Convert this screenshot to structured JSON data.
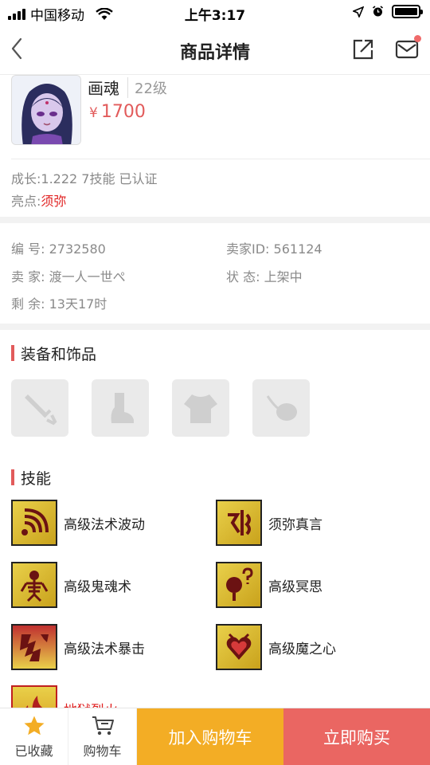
{
  "status_bar": {
    "carrier": "中国移动",
    "time": "上午3:17"
  },
  "nav": {
    "title": "商品详情"
  },
  "pet": {
    "name": "画魂",
    "level": "22级",
    "currency": "¥",
    "price": "1700"
  },
  "summary": {
    "growth_line": "成长:1.222 7技能 已认证",
    "highlight_label": "亮点:",
    "highlight_value": "须弥"
  },
  "info": {
    "id_label": "编 号:",
    "id_value": "2732580",
    "seller_id_label": "卖家ID:",
    "seller_id_value": "561124",
    "seller_label": "卖 家:",
    "seller_value": "渡一人一世ぺ",
    "status_label": "状 态:",
    "status_value": "上架中",
    "remain_label": "剩 余:",
    "remain_value": "13天17时"
  },
  "sections": {
    "equipment_title": "装备和饰品",
    "skills_title": "技能"
  },
  "equipment": [
    {
      "icon": "sword-icon"
    },
    {
      "icon": "boot-icon"
    },
    {
      "icon": "armor-icon"
    },
    {
      "icon": "ornament-icon"
    }
  ],
  "skills": [
    {
      "label": "高级法术波动"
    },
    {
      "label": "须弥真言"
    },
    {
      "label": "高级鬼魂术"
    },
    {
      "label": "高级冥思"
    },
    {
      "label": "高级法术暴击"
    },
    {
      "label": "高级魔之心"
    },
    {
      "label": "地狱烈火"
    }
  ],
  "bottom_bar": {
    "favorite_label": "已收藏",
    "cart_label": "购物车",
    "add_cart_label": "加入购物车",
    "buy_label": "立即购买"
  },
  "colors": {
    "accent_red": "#e25b5b",
    "highlight_red": "#e02020",
    "cart_button": "#f3ad25",
    "buy_button": "#ea6662",
    "favorite_star": "#f3ad25"
  }
}
